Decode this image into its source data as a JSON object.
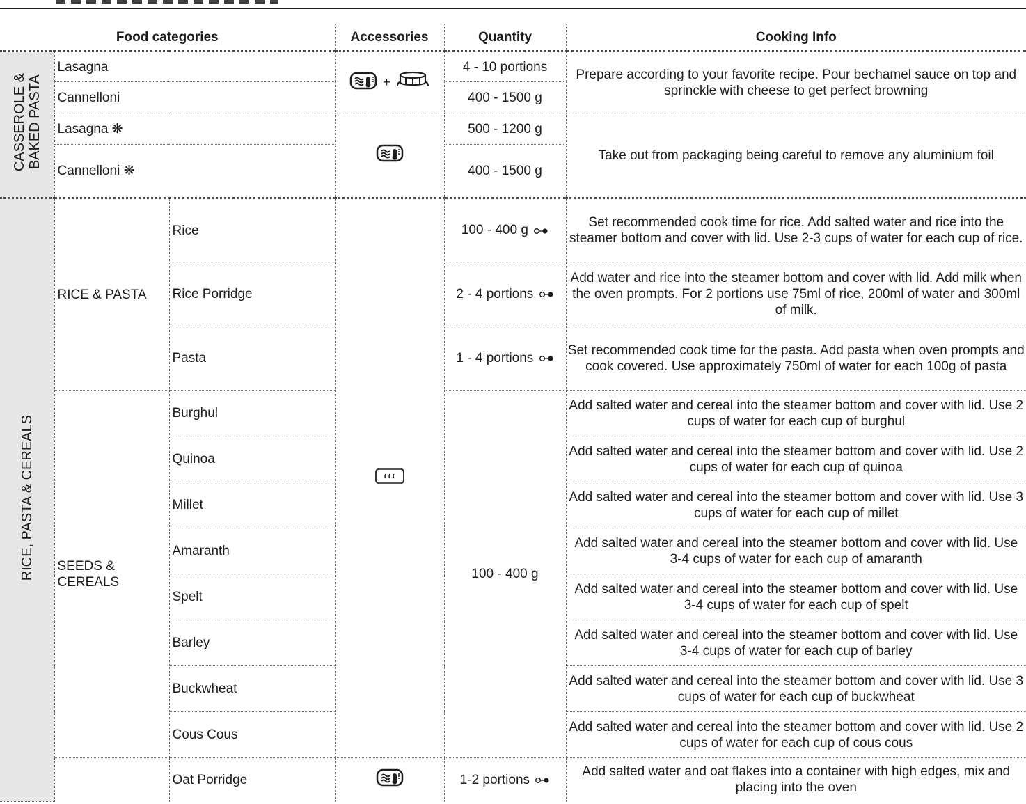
{
  "header": {
    "food_categories": "Food categories",
    "accessories": "Accessories",
    "quantity": "Quantity",
    "cooking_info": "Cooking Info"
  },
  "sections": {
    "casserole_label": "CASSEROLE &\nBAKED PASTA",
    "rice_label": "RICE, PASTA & CEREALS",
    "rice_pasta": "RICE & PASTA",
    "seeds_cereals": "SEEDS &\nCEREALS"
  },
  "casserole_rows": [
    {
      "food": "Lasagna",
      "quantity": "4 - 10 portions"
    },
    {
      "food": "Cannelloni",
      "quantity": "400 - 1500 g"
    },
    {
      "food": "Lasagna ❋",
      "quantity": "500 - 1200 g"
    },
    {
      "food": "Cannelloni ❋",
      "quantity": "400 - 1500 g"
    }
  ],
  "casserole_info": [
    "Prepare according to your favorite recipe. Pour bechamel sauce on top and sprinckle with cheese to get perfect browning",
    "Take out from packaging being careful to remove any aluminium foil"
  ],
  "plus_sign": "+",
  "rice_rows": [
    {
      "food": "Rice",
      "quantity": "100 - 400 g",
      "info": "Set recommended cook time for rice. Add salted water and rice into the steamer bottom and cover with lid. Use 2-3 cups of water for each cup of rice."
    },
    {
      "food": "Rice Porridge",
      "quantity": "2 - 4 portions",
      "info": "Add water and rice into the steamer bottom and cover with lid. Add milk when the oven prompts. For 2 portions use 75ml of rice, 200ml of water and 300ml of milk."
    },
    {
      "food": "Pasta",
      "quantity": "1 - 4 portions",
      "info": "Set recommended cook time for the pasta. Add pasta when oven prompts and cook covered. Use approximately 750ml of water for each 100g of pasta"
    }
  ],
  "seeds_quantity": "100 - 400 g",
  "seeds_rows": [
    {
      "food": "Burghul",
      "info": "Add salted water and cereal into the steamer bottom and cover with lid. Use 2 cups of water for each cup of burghul"
    },
    {
      "food": "Quinoa",
      "info": "Add salted water and cereal into the steamer bottom and cover with lid. Use 2 cups of water for each cup of quinoa"
    },
    {
      "food": "Millet",
      "info": "Add salted water and cereal into the steamer bottom and cover with lid. Use 3 cups of water for each cup of millet"
    },
    {
      "food": "Amaranth",
      "info": "Add salted water and cereal into the steamer bottom and cover with lid. Use 3-4 cups of water for each cup of amaranth"
    },
    {
      "food": "Spelt",
      "info": "Add salted water and cereal into the steamer bottom and cover with lid. Use 3-4 cups of water for each cup of spelt"
    },
    {
      "food": "Barley",
      "info": "Add salted water and cereal into the steamer bottom and cover with lid. Use 3-4 cups of water for each cup of barley"
    },
    {
      "food": "Buckwheat",
      "info": "Add salted water and cereal into the steamer bottom and cover with lid. Use 3 cups of water for each cup of buckwheat"
    },
    {
      "food": "Cous Cous",
      "info": "Add salted water and cereal into the steamer bottom and cover with lid. Use 2 cups of water for each cup of cous cous"
    }
  ],
  "oat_row": {
    "food": "Oat Porridge",
    "quantity": "1-2 portions",
    "info": "Add salted water and oat flakes into a container with high edges, mix and placing into the oven"
  },
  "icons": {
    "oven_dish": "oven-dish-icon",
    "rack": "rack-icon",
    "steamer": "steamer-icon",
    "progress": "progress-dots-icon"
  }
}
